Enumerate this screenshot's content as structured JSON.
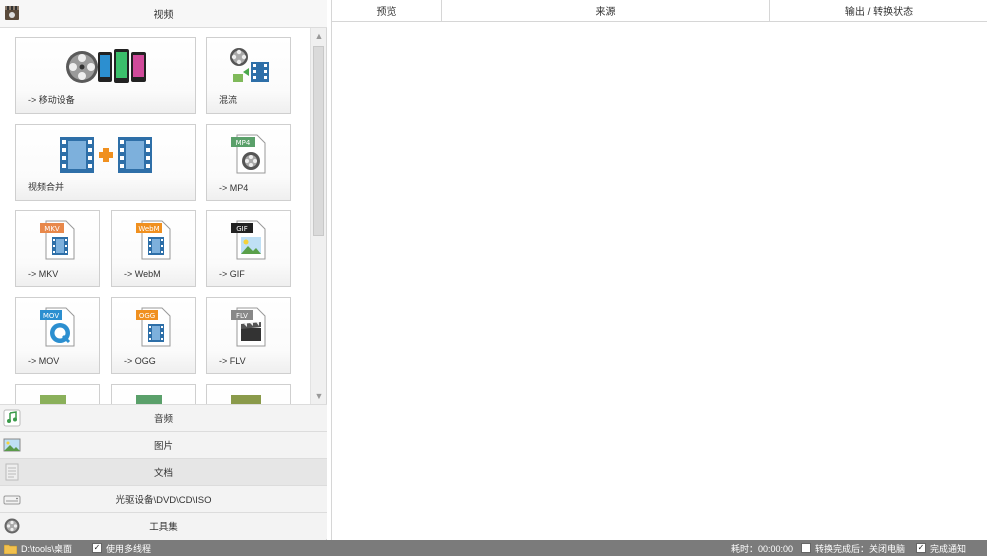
{
  "left_panel": {
    "header": {
      "icon": "video-category-icon",
      "title": "视频"
    },
    "tiles": [
      {
        "label": "-> 移动设备",
        "icon": "mobile-devices-icon"
      },
      {
        "label": "混流",
        "icon": "mux-icon"
      },
      {
        "label": "视频合并",
        "icon": "video-merge-icon"
      },
      {
        "label": "-> MP4",
        "icon": "mp4-file-icon",
        "badge": "MP4"
      },
      {
        "label": "-> MKV",
        "icon": "mkv-file-icon",
        "badge": "MKV"
      },
      {
        "label": "-> WebM",
        "icon": "webm-file-icon",
        "badge": "WebM"
      },
      {
        "label": "-> GIF",
        "icon": "gif-file-icon",
        "badge": "GIF"
      },
      {
        "label": "-> MOV",
        "icon": "mov-file-icon",
        "badge": "MOV"
      },
      {
        "label": "-> OGG",
        "icon": "ogg-file-icon",
        "badge": "OGG"
      },
      {
        "label": "-> FLV",
        "icon": "flv-file-icon",
        "badge": "FLV"
      }
    ],
    "categories": [
      {
        "label": "音频",
        "icon": "music-note-icon"
      },
      {
        "label": "图片",
        "icon": "picture-icon"
      },
      {
        "label": "文档",
        "icon": "document-icon"
      },
      {
        "label": "光驱设备\\DVD\\CD\\ISO",
        "icon": "optical-drive-icon"
      },
      {
        "label": "工具集",
        "icon": "toolbox-icon"
      }
    ]
  },
  "task_list": {
    "columns": [
      "预览",
      "来源",
      "输出 / 转换状态"
    ]
  },
  "status_bar": {
    "output_path": "D:\\tools\\桌面",
    "multithread_label": "使用多线程",
    "multithread_checked": true,
    "elapsed": "耗时：00:00:00",
    "after_convert_label": "转换完成后：关闭电脑",
    "after_convert_checked": false,
    "notify_label": "完成通知",
    "notify_checked": true
  },
  "colors": {
    "status_bar_bg": "#7b7b7b",
    "panel_bg": "#f3f3f3",
    "film_blue": "#2e6fa8",
    "merge_orange": "#f0901f"
  }
}
